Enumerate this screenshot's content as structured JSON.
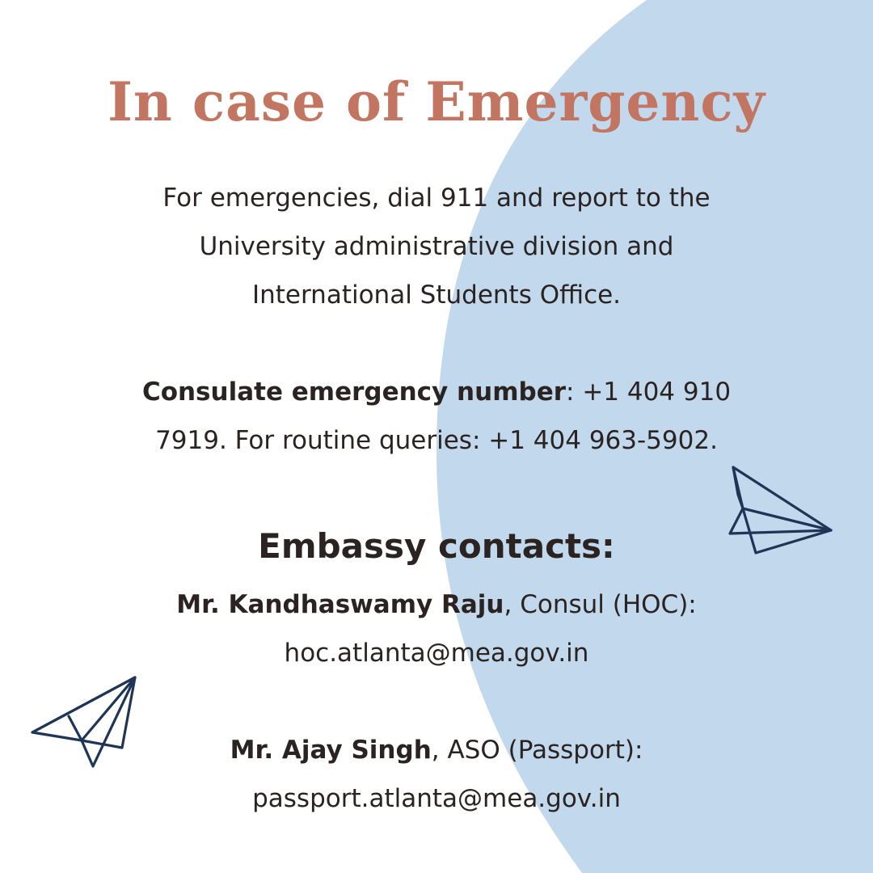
{
  "title": "In case of Emergency",
  "intro": "For emergencies, dial 911 and report to the University administrative division and International Students Office.",
  "consulate": {
    "label": "Consulate emergency number",
    "text": ": +1 404 910 7919. For routine queries: +1 404 963-5902."
  },
  "embassy_heading": "Embassy contacts:",
  "contacts": [
    {
      "name": "Mr. Kandhaswamy Raju",
      "role": ", Consul (HOC):",
      "email": "hoc.atlanta@mea.gov.in"
    },
    {
      "name": "Mr. Ajay Singh",
      "role": ", ASO (Passport):",
      "email": "passport.atlanta@mea.gov.in"
    }
  ],
  "colors": {
    "background": "#ffffff",
    "blob": "#c2d8ec",
    "title": "#c27560",
    "text": "#2a2321",
    "plane_stroke": "#1f3556"
  },
  "icons": [
    "paper-plane-icon",
    "paper-plane-icon"
  ]
}
